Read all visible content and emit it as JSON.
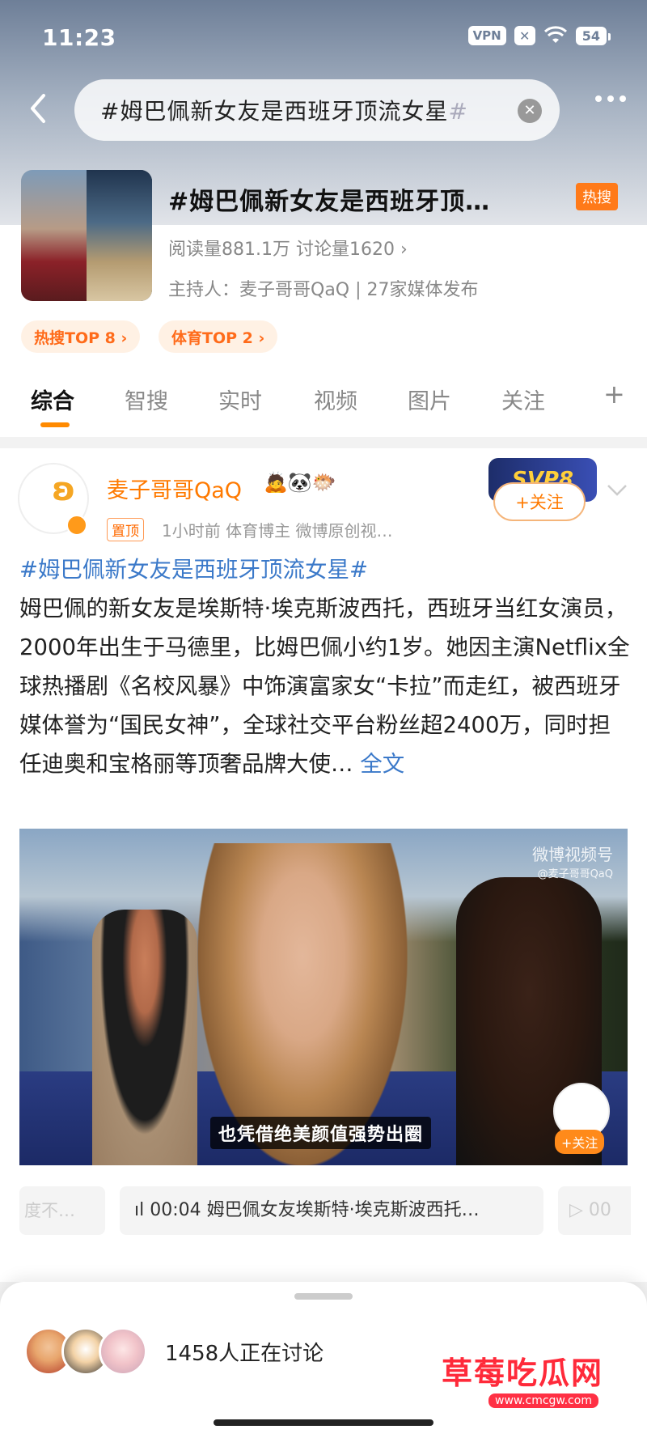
{
  "status_bar": {
    "time": "11:23",
    "vpn": "VPN",
    "x_badge": "✕",
    "battery": "54"
  },
  "search": {
    "query": "#姆巴佩新女友是西班牙顶流女星",
    "query_tail": "#"
  },
  "topic": {
    "title": "#姆巴佩新女友是西班牙顶…",
    "hot_badge": "热搜",
    "stats": "阅读量881.1万  讨论量1620  ›",
    "host": "主持人：麦子哥哥QaQ | 27家媒体发布",
    "chips": [
      "热搜TOP 8 ›",
      "体育TOP 2 ›"
    ]
  },
  "tabs": [
    "综合",
    "智搜",
    "实时",
    "视频",
    "图片",
    "关注",
    "+"
  ],
  "post": {
    "author": "麦子哥哥QaQ",
    "emojis": "🙇🐼🐡",
    "pin": "置顶",
    "meta": "1小时前   体育博主  微博原创视…",
    "follow_label": "+关注",
    "hashtag": "#姆巴佩新女友是西班牙顶流女星#",
    "body": "姆巴佩的新女友是埃斯特·埃克斯波西托，西班牙当红女演员，2000年出生于马德里，比姆巴佩小约1岁。她因主演Netflix全球热播剧《名校风暴》中饰演富家女“卡拉”而走红，被西班牙媒体誉为“国民女神”，全球社交平台粉丝超2400万，同时担任迪奥和宝格丽等顶奢品牌大使…",
    "fulltext_link": "全文"
  },
  "video": {
    "watermark": "微博视频号",
    "watermark_handle": "@麦子哥哥QaQ",
    "subtitle": "也凭借绝美颜值强势出圈",
    "follow_label": "+关注"
  },
  "chapters": {
    "left": "度不…",
    "main": "ıl 00:04  姆巴佩女友埃斯特·埃克斯波西托…",
    "right": "▷ 00"
  },
  "sheet": {
    "discuss_count": "1458人正在讨论"
  },
  "watermark_site": {
    "logo": "草莓吃瓜网",
    "url": "www.cmcgw.com"
  }
}
